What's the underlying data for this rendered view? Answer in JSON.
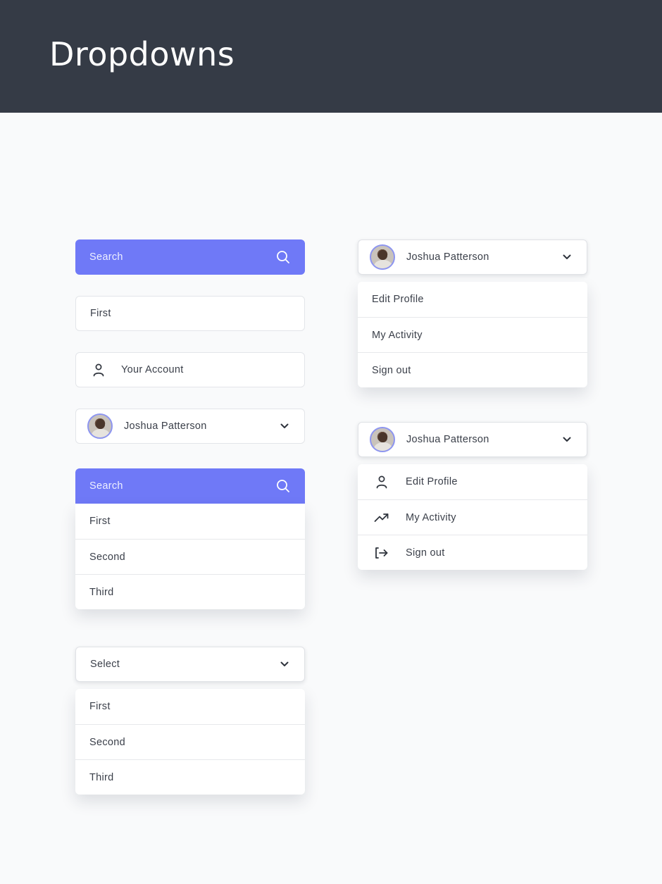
{
  "page": {
    "title": "Dropdowns"
  },
  "left": {
    "search1": {
      "label": "Search",
      "icon": "search-icon"
    },
    "first_input": {
      "value": "First"
    },
    "account": {
      "label": "Your Account",
      "icon": "user-icon"
    },
    "user_select": {
      "name": "Joshua Patterson",
      "icon": "chevron-down-icon"
    },
    "search_menu": {
      "label": "Search",
      "items": [
        "First",
        "Second",
        "Third"
      ]
    },
    "select_menu": {
      "label": "Select",
      "items": [
        "First",
        "Second",
        "Third"
      ]
    }
  },
  "right": {
    "profile_menu_1": {
      "name": "Joshua Patterson",
      "items": [
        "Edit Profile",
        "My Activity",
        "Sign out"
      ]
    },
    "profile_menu_2": {
      "name": "Joshua Patterson",
      "items": [
        {
          "label": "Edit Profile",
          "icon": "user-icon"
        },
        {
          "label": "My Activity",
          "icon": "trending-up-icon"
        },
        {
          "label": "Sign out",
          "icon": "sign-out-icon"
        }
      ]
    }
  },
  "colors": {
    "header": "#353b46",
    "accent": "#6f79f7",
    "background": "#f9fafb"
  }
}
